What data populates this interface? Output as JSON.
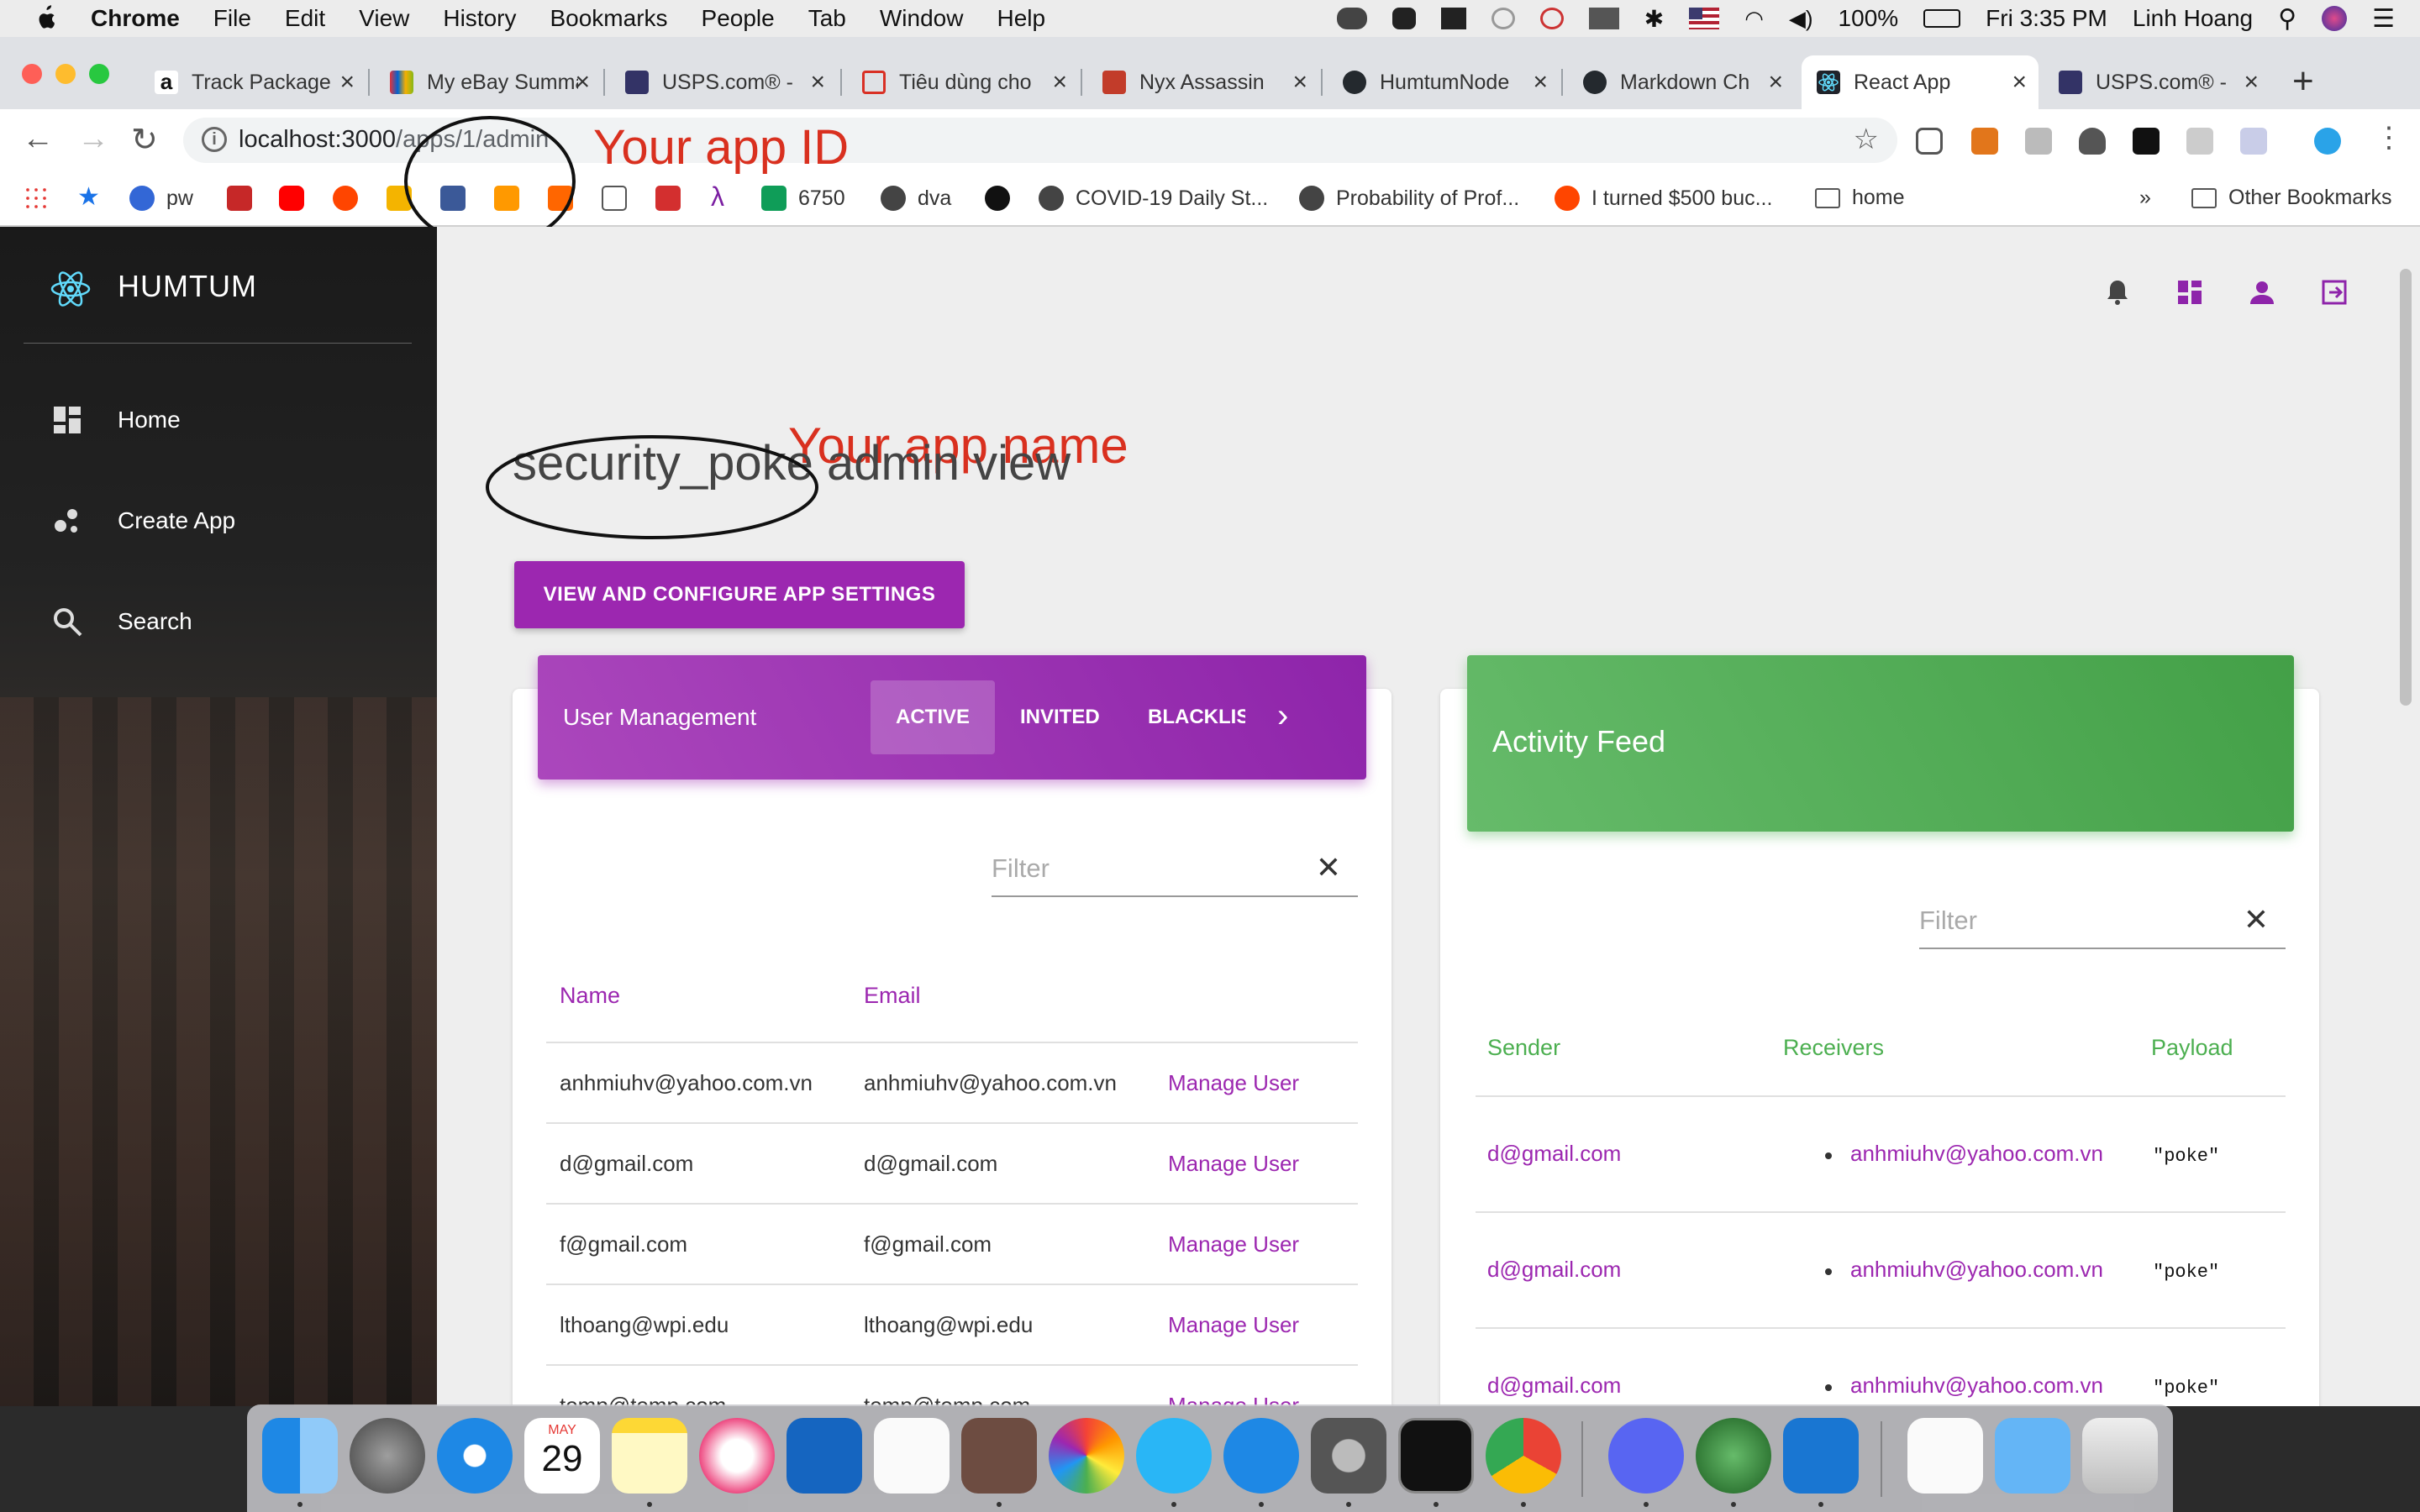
{
  "menubar": {
    "app": "Chrome",
    "items": [
      "File",
      "Edit",
      "View",
      "History",
      "Bookmarks",
      "People",
      "Tab",
      "Window",
      "Help"
    ],
    "battery": "100%",
    "clock": "Fri 3:35 PM",
    "user": "Linh Hoang"
  },
  "tabs": [
    {
      "title": "Track Package",
      "icon": "amazon-icon",
      "color": "#ffffff"
    },
    {
      "title": "My eBay Summary",
      "icon": "ebay-icon",
      "color": "#e53238"
    },
    {
      "title": "USPS.com® -",
      "icon": "usps-icon",
      "color": "#333366"
    },
    {
      "title": "Tiêu dùng cho",
      "icon": "news-icon",
      "color": "#d93025"
    },
    {
      "title": "Nyx Assassin",
      "icon": "dota-icon",
      "color": "#c23c2a"
    },
    {
      "title": "HumtumNode",
      "icon": "github-icon",
      "color": "#24292e"
    },
    {
      "title": "Markdown Ch",
      "icon": "github-icon",
      "color": "#24292e"
    },
    {
      "title": "React App",
      "icon": "react-icon",
      "color": "#20232a"
    },
    {
      "title": "USPS.com® -",
      "icon": "usps-icon",
      "color": "#333366"
    }
  ],
  "omnibox": {
    "host": "localhost:3000",
    "path": "/apps/1/admin"
  },
  "bookmarks": [
    {
      "label": "pw",
      "icon": "gear-icon"
    },
    {
      "label": "6750",
      "icon": "sheets-icon"
    },
    {
      "label": "dva",
      "icon": "globe-icon"
    },
    {
      "label": "COVID-19 Daily St...",
      "icon": "globe-icon"
    },
    {
      "label": "Probability of Prof...",
      "icon": "globe-icon"
    },
    {
      "label": "I turned $500 buc...",
      "icon": "reddit-icon"
    },
    {
      "label": "home",
      "icon": "folder-icon"
    },
    {
      "label": "Other Bookmarks",
      "icon": "folder-icon"
    }
  ],
  "bookmarks_overflow": "»",
  "annotations": {
    "app_id": "Your app ID",
    "app_name": "Your app name"
  },
  "sidebar": {
    "brand": "HUMTUM",
    "items": [
      {
        "label": "Home",
        "icon": "dashboard-icon"
      },
      {
        "label": "Create App",
        "icon": "bubbles-icon"
      },
      {
        "label": "Search",
        "icon": "search-icon"
      }
    ]
  },
  "header": {
    "app_name": "security_poke",
    "title_suffix": "admin view"
  },
  "config_button": "VIEW AND CONFIGURE APP SETTINGS",
  "user_management": {
    "title": "User Management",
    "tabs": [
      "ACTIVE",
      "INVITED",
      "BLACKLIST"
    ],
    "filter_placeholder": "Filter",
    "columns": [
      "Name",
      "Email"
    ],
    "action_label": "Manage User",
    "rows": [
      {
        "name": "anhmiuhv@yahoo.com.vn",
        "email": "anhmiuhv@yahoo.com.vn"
      },
      {
        "name": "d@gmail.com",
        "email": "d@gmail.com"
      },
      {
        "name": "f@gmail.com",
        "email": "f@gmail.com"
      },
      {
        "name": "lthoang@wpi.edu",
        "email": "lthoang@wpi.edu"
      },
      {
        "name": "temp@temp.com",
        "email": "temp@temp.com"
      }
    ]
  },
  "activity_feed": {
    "title": "Activity Feed",
    "filter_placeholder": "Filter",
    "columns": [
      "Sender",
      "Receivers",
      "Payload"
    ],
    "rows": [
      {
        "sender": "d@gmail.com",
        "receiver": "anhmiuhv@yahoo.com.vn",
        "payload": "\"poke\""
      },
      {
        "sender": "d@gmail.com",
        "receiver": "anhmiuhv@yahoo.com.vn",
        "payload": "\"poke\""
      },
      {
        "sender": "d@gmail.com",
        "receiver": "anhmiuhv@yahoo.com.vn",
        "payload": "\"poke\""
      }
    ]
  },
  "dock": {
    "calendar_month": "MAY",
    "calendar_day": "29",
    "apps": [
      "finder-icon",
      "launchpad-icon",
      "safari-icon",
      "calendar-icon",
      "notes-icon",
      "music-icon",
      "affinity-icon",
      "reminders-icon",
      "preview-icon",
      "photos-icon",
      "messages-icon",
      "appstore-icon",
      "settings-icon",
      "terminal-icon",
      "chrome-icon",
      "discord-icon",
      "network-icon",
      "vscode-icon",
      "document-icon",
      "downloads-folder-icon",
      "trash-icon"
    ]
  },
  "colors": {
    "accent": "#9c27b0",
    "feed": "#4caf50",
    "annotation": "#d9301f"
  }
}
